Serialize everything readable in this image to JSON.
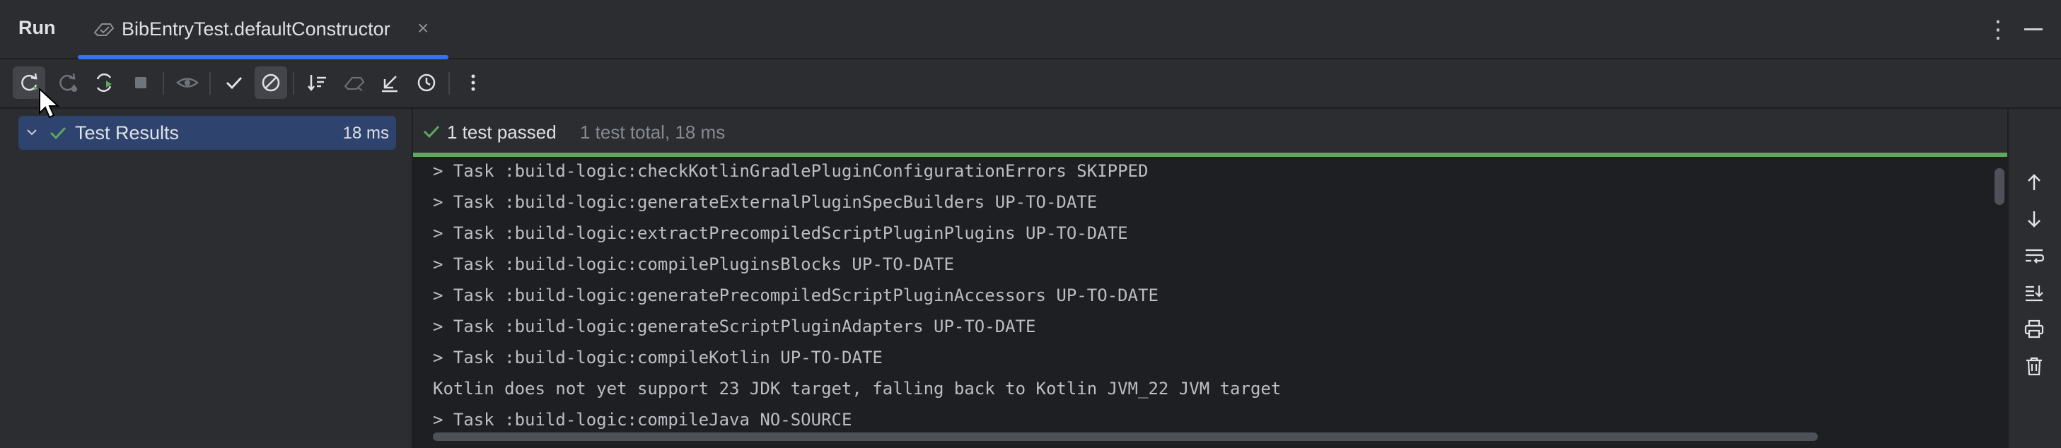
{
  "header": {
    "title": "Run",
    "tab_label": "BibEntryTest.defaultConstructor",
    "tab_close": "×",
    "more": "⋮"
  },
  "toolbar": {
    "buttons": [
      "rerun-icon",
      "rerun-failed-icon",
      "toggle-auto-test-icon",
      "stop-icon",
      "show-passed-icon",
      "show-ignored-icon",
      "sort-icon",
      "import-tests-icon",
      "export-tests-icon",
      "history-icon",
      "more-icon"
    ]
  },
  "tree": {
    "root_label": "Test Results",
    "root_time": "18 ms"
  },
  "status": {
    "passed": "1 test passed",
    "total": "1 test total, 18 ms"
  },
  "console": {
    "lines": [
      "> Task :build-logic:checkKotlinGradlePluginConfigurationErrors SKIPPED",
      "> Task :build-logic:generateExternalPluginSpecBuilders UP-TO-DATE",
      "> Task :build-logic:extractPrecompiledScriptPluginPlugins UP-TO-DATE",
      "> Task :build-logic:compilePluginsBlocks UP-TO-DATE",
      "> Task :build-logic:generatePrecompiledScriptPluginAccessors UP-TO-DATE",
      "> Task :build-logic:generateScriptPluginAdapters UP-TO-DATE",
      "> Task :build-logic:compileKotlin UP-TO-DATE",
      "Kotlin does not yet support 23 JDK target, falling back to Kotlin JVM_22 JVM target",
      "> Task :build-logic:compileJava NO-SOURCE"
    ]
  },
  "colors": {
    "background": "#2b2d30",
    "console_bg": "#1e1f22",
    "accent": "#3574f0",
    "success": "#5ea95d",
    "selection": "#2e436e"
  }
}
